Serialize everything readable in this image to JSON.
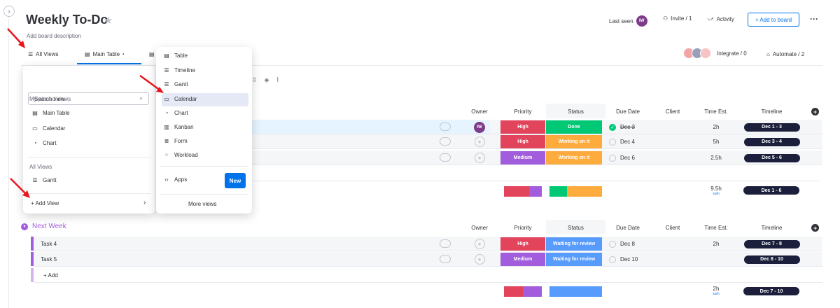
{
  "board": {
    "title": "Weekly To-Do",
    "description": "Add board description"
  },
  "header": {
    "last_seen": "Last seen",
    "avatar_initials": "IW",
    "invite": "Invite / 1",
    "activity": "Activity",
    "add_to_board": "+ Add to board"
  },
  "views": {
    "all_views": "All Views",
    "main_table": "Main Table",
    "integrate": "Integrate / 0",
    "automate": "Automate / 2"
  },
  "columns": {
    "owner": "Owner",
    "priority": "Priority",
    "status": "Status",
    "due_date": "Due Date",
    "client": "Client",
    "time_est": "Time Est.",
    "timeline": "Timeline"
  },
  "group1": {
    "rows": [
      {
        "priority": "High",
        "status": "Done",
        "due": "Dec 3",
        "time": "2h",
        "timeline": "Dec 1 - 3",
        "owner": "IW"
      },
      {
        "priority": "High",
        "status": "Working on it",
        "due": "Dec 4",
        "time": "5h",
        "timeline": "Dec 3 - 4"
      },
      {
        "priority": "Medium",
        "status": "Working on it",
        "due": "Dec 6",
        "time": "2.5h",
        "timeline": "Dec 5 - 6"
      }
    ],
    "summary": {
      "time": "9.5h",
      "time_sub": "sum",
      "timeline": "Dec 1 - 6"
    }
  },
  "group2": {
    "title": "Next Week",
    "rows": [
      {
        "name": "Task 4",
        "priority": "High",
        "status": "Waiting for review",
        "due": "Dec 8",
        "time": "2h",
        "timeline": "Dec 7 - 8"
      },
      {
        "name": "Task 5",
        "priority": "Medium",
        "status": "Waiting for review",
        "due": "Dec 10",
        "time": "",
        "timeline": "Dec 8 - 10"
      }
    ],
    "add_label": "+ Add",
    "summary": {
      "time": "2h",
      "time_sub": "sum",
      "timeline": "Dec 7 - 10"
    }
  },
  "views_panel": {
    "search_placeholder": "Search view",
    "pinned_heading": "My pinned views",
    "pinned": [
      "Main Table",
      "Calendar",
      "Chart"
    ],
    "all_heading": "All Views",
    "all": [
      "Gantt"
    ],
    "add_view": "+ Add View"
  },
  "add_view_menu": {
    "items": [
      "Table",
      "Timeline",
      "Gantt",
      "Calendar",
      "Chart",
      "Kanban",
      "Form",
      "Workload"
    ],
    "apps": "Apps",
    "new_badge": "New",
    "more_views": "More views"
  },
  "colors": {
    "high": "#e2445c",
    "medium": "#a25ddc",
    "done": "#00c875",
    "working": "#fdab3d",
    "waiting": "#579bfc",
    "accent": "#0073ea"
  }
}
